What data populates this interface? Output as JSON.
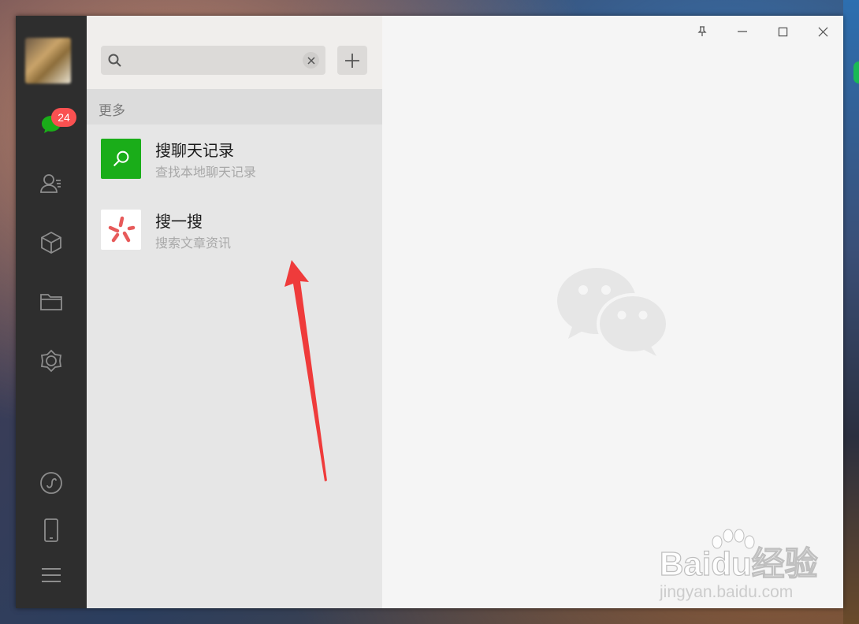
{
  "nav": {
    "chat_badge": "24",
    "icons": [
      "chat-icon",
      "contacts-icon",
      "favorites-icon",
      "files-icon",
      "moments-icon",
      "mini-program-icon",
      "phone-icon",
      "menu-icon"
    ]
  },
  "search": {
    "value": "",
    "placeholder": ""
  },
  "section": {
    "header": "更多"
  },
  "results": [
    {
      "title": "搜聊天记录",
      "subtitle": "查找本地聊天记录",
      "icon": "chat-history-search-icon"
    },
    {
      "title": "搜一搜",
      "subtitle": "搜索文章资讯",
      "icon": "sousou-icon"
    }
  ],
  "titlebar": {
    "buttons": [
      "pin-icon",
      "minimize-icon",
      "maximize-icon",
      "close-icon"
    ]
  },
  "watermark": {
    "brand": "Baidu经验",
    "site": "jingyan.baidu.com"
  },
  "colors": {
    "nav_bg": "#2e2e2e",
    "list_bg": "#e6e6e6",
    "accent_green": "#1aad19",
    "badge_red": "#fa5151",
    "annotation_arrow": "#ef3b3b"
  }
}
